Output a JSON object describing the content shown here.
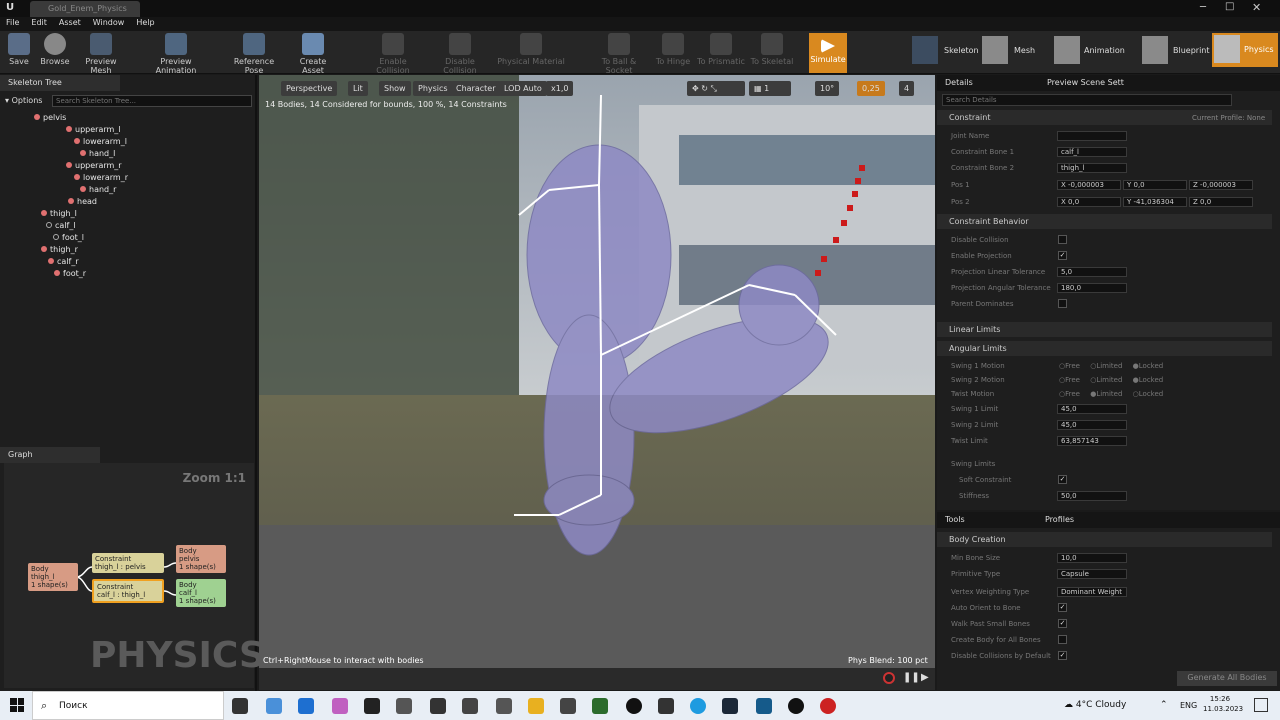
{
  "app": {
    "tab_title": "Gold_Enem_Physics"
  },
  "menu": [
    "File",
    "Edit",
    "Asset",
    "Window",
    "Help"
  ],
  "toolbar": {
    "buttons": [
      "Save",
      "Browse",
      "Preview Mesh",
      "Preview Animation",
      "Reference Pose",
      "Create Asset",
      "Enable Collision",
      "Disable Collision",
      "Physical Material",
      "To Ball & Socket",
      "To Hinge",
      "To Prismatic",
      "To Skeletal",
      "Simulate"
    ],
    "modes": [
      "Skeleton",
      "Mesh",
      "Animation",
      "Blueprint",
      "Physics"
    ]
  },
  "skeleton_tree": {
    "tab": "Skeleton Tree",
    "options": "Options",
    "search_placeholder": "Search Skeleton Tree...",
    "bones": [
      "pelvis",
      "upperarm_l",
      "lowerarm_l",
      "hand_l",
      "upperarm_r",
      "lowerarm_r",
      "hand_r",
      "head",
      "thigh_l",
      "calf_l",
      "foot_l",
      "thigh_r",
      "calf_r",
      "foot_r"
    ]
  },
  "graph": {
    "tab": "Graph",
    "zoom": "Zoom 1:1",
    "watermark": "PHYSICS",
    "nodes": {
      "body_thigh": "Body\nthigh_l\n1 shape(s)",
      "constraint_1": "Constraint\nthigh_l : pelvis",
      "constraint_2": "Constraint\ncalf_l : thigh_l",
      "body_pelvis": "Body\npelvis\n1 shape(s)",
      "body_calf": "Body\ncalf_l\n1 shape(s)"
    }
  },
  "viewport": {
    "buttons": [
      "Perspective",
      "Lit",
      "Show",
      "Physics",
      "Character",
      "LOD Auto",
      "x1,0"
    ],
    "right_controls": [
      "10°",
      "0,25",
      "4"
    ],
    "stats": "14 Bodies, 14 Considered for bounds, 100 %, 14 Constraints",
    "hint": "Ctrl+RightMouse to interact with bodies",
    "phys_blend": "Phys Blend: 100 pct"
  },
  "details": {
    "tabs": [
      "Details",
      "Preview Scene Sett"
    ],
    "search_placeholder": "Search Details",
    "constraint_header": "Constraint",
    "current_profile": "Current Profile: None",
    "joint_name": "Joint Name",
    "bone1_label": "Constraint Bone 1",
    "bone1_value": "calf_l",
    "bone2_label": "Constraint Bone 2",
    "bone2_value": "thigh_l",
    "pos1_label": "Pos 1",
    "pos1": [
      "X -0,000003",
      "Y 0,0",
      "Z -0,000003"
    ],
    "pos2_label": "Pos 2",
    "pos2": [
      "X 0,0",
      "Y -41,036304",
      "Z 0,0"
    ],
    "behavior_header": "Constraint Behavior",
    "disable_collision": "Disable Collision",
    "enable_projection": "Enable Projection",
    "proj_linear": "Projection Linear Tolerance",
    "proj_linear_val": "5,0",
    "proj_angular": "Projection Angular Tolerance",
    "proj_angular_val": "180,0",
    "parent_dominates": "Parent Dominates",
    "linear_limits": "Linear Limits",
    "angular_limits": "Angular Limits",
    "swing1_motion": "Swing 1 Motion",
    "swing2_motion": "Swing 2 Motion",
    "twist_motion": "Twist Motion",
    "motion_opts": [
      "Free",
      "Limited",
      "Locked"
    ],
    "swing1_limit": "Swing 1 Limit",
    "swing1_val": "45,0",
    "swing2_limit": "Swing 2 Limit",
    "swing2_val": "45,0",
    "twist_limit": "Twist Limit",
    "twist_val": "63,857143",
    "swing_limits": "Swing Limits",
    "soft_constraint": "Soft Constraint",
    "stiffness": "Stiffness",
    "stiffness_val": "50,0"
  },
  "tools": {
    "tabs": [
      "Tools",
      "Profiles"
    ],
    "body_creation": "Body Creation",
    "min_bone_size": "Min Bone Size",
    "min_bone_size_val": "10,0",
    "primitive_type": "Primitive Type",
    "primitive_type_val": "Capsule",
    "vertex_weighting": "Vertex Weighting Type",
    "vertex_weighting_val": "Dominant Weight",
    "auto_orient": "Auto Orient to Bone",
    "walk_past": "Walk Past Small Bones",
    "create_all": "Create Body for All Bones",
    "disable_coll_default": "Disable Collisions by Default",
    "generate": "Generate All Bodies"
  },
  "taskbar": {
    "search": "Поиск",
    "weather": "4°C  Cloudy",
    "lang": "ENG",
    "time": "15:26",
    "date": "11.03.2023"
  }
}
